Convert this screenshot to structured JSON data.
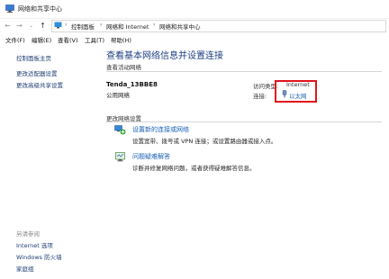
{
  "window": {
    "title": "网络和共享中心"
  },
  "address": {
    "breadcrumbs": [
      "控制面板",
      "网络和 Internet",
      "网络和共享中心"
    ]
  },
  "menu": [
    "文件(F)",
    "编辑(E)",
    "查看(V)",
    "工具(T)",
    "帮助(H)"
  ],
  "sidebar": {
    "links": [
      "控制面板主页",
      "更改适配器设置",
      "更改高级共享设置"
    ],
    "see_also_label": "另请参阅",
    "see_also": [
      "Internet 选项",
      "Windows 防火墙",
      "家庭组"
    ]
  },
  "main": {
    "title": "查看基本网络信息并设置连接",
    "active_networks_heading": "查看活动网络",
    "network": {
      "name": "Tenda_13BBE8",
      "category": "公用网络",
      "access_type_label": "访问类型:",
      "access_type_value": "Internet",
      "connection_label": "连接:",
      "connection_value": "以太网"
    },
    "change_heading": "更改网络设置",
    "tasks": [
      {
        "title": "设置新的连接或网络",
        "desc": "设置宽带、拨号或 VPN 连接；或设置路由器或接入点。",
        "icon": "new-connection-icon"
      },
      {
        "title": "问题疑难解答",
        "desc": "诊断并修复网络问题，或者获得疑难解答信息。",
        "icon": "troubleshoot-icon"
      }
    ]
  },
  "colors": {
    "highlight_box": "#e0141b",
    "link": "#1a5fb4",
    "title": "#1e3f84"
  }
}
